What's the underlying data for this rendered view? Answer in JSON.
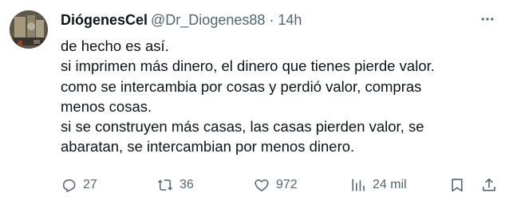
{
  "author": {
    "display_name": "DiógenesCel",
    "handle": "@Dr_Diogenes88",
    "separator": "·",
    "time": "14h"
  },
  "tweet": {
    "lines": [
      "de hecho es así.",
      "si imprimen más dinero, el dinero que tienes pierde valor.",
      "como se intercambia por cosas y perdió valor, compras",
      "menos cosas.",
      "si se construyen más casas, las casas pierden valor, se",
      "abaratan, se intercambian por menos dinero."
    ]
  },
  "actions": {
    "replies": "27",
    "retweets": "36",
    "likes": "972",
    "views": "24 mil"
  },
  "icons": {
    "more": "more-dots-icon",
    "reply": "reply-icon",
    "retweet": "retweet-icon",
    "like": "heart-icon",
    "views": "views-icon",
    "bookmark": "bookmark-icon",
    "share": "share-icon"
  },
  "colors": {
    "text": "#0f1419",
    "secondary": "#536471",
    "background": "#ffffff"
  }
}
